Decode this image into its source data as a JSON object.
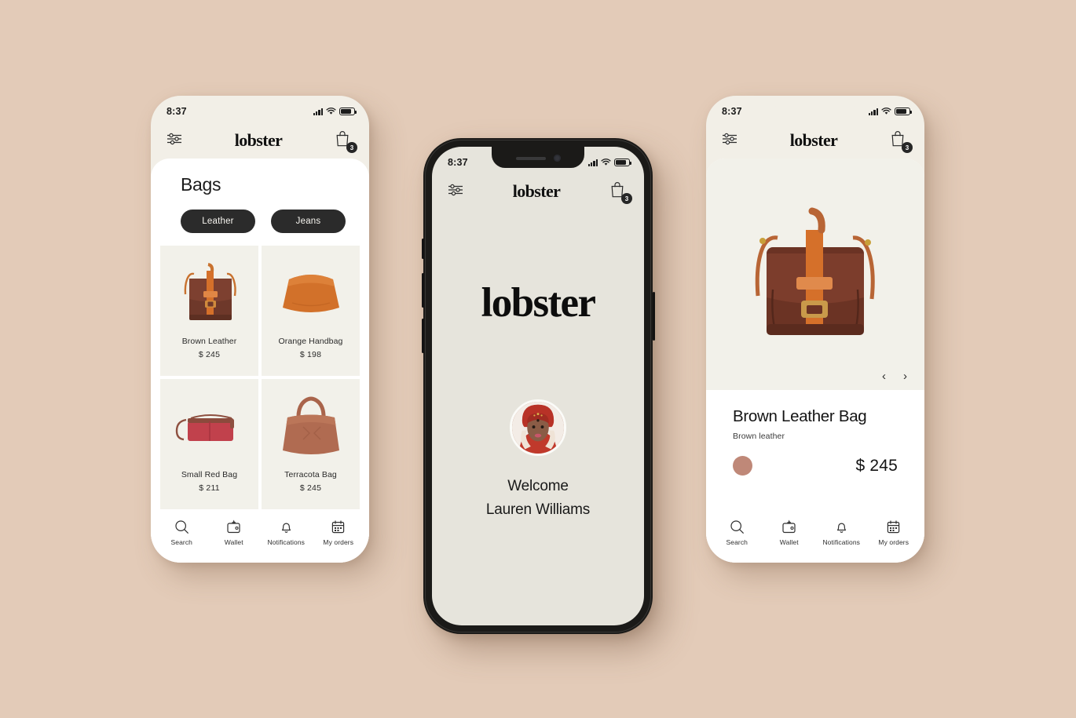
{
  "background_color": "#e3cbb8",
  "brand": "lobster",
  "status_bar": {
    "time": "8:37",
    "signal_icon": "cellular-signal-icon",
    "wifi_icon": "wifi-icon",
    "battery_icon": "battery-icon"
  },
  "header": {
    "filter_icon": "filter-sliders-icon",
    "cart_icon": "shopping-bag-icon",
    "cart_count": "3"
  },
  "catalogue_screen": {
    "title": "Bags",
    "filters": [
      {
        "label": "Leather"
      },
      {
        "label": "Jeans"
      }
    ],
    "products": [
      {
        "name": "Brown Leather",
        "price": "$ 245",
        "color": "#7b3f2c",
        "accent": "#d5702a"
      },
      {
        "name": "Orange Handbag",
        "price": "$ 198",
        "color": "#d2712a",
        "accent": "#b85d1d"
      },
      {
        "name": "Small Red Bag",
        "price": "$ 211",
        "color": "#c1414c",
        "accent": "#8e5040"
      },
      {
        "name": "Terracota Bag",
        "price": "$ 245",
        "color": "#b06b51",
        "accent": "#9c5b43"
      }
    ]
  },
  "welcome_screen": {
    "greeting": "Welcome",
    "user_name": "Lauren Williams",
    "avatar_icon": "user-avatar"
  },
  "detail_screen": {
    "product_title": "Brown Leather Bag",
    "product_subtitle": "Brown leather",
    "price": "$ 245",
    "color_swatch": "#bf8878",
    "prev_arrow": "‹",
    "next_arrow": "›"
  },
  "tabbar": {
    "items": [
      {
        "label": "Search",
        "icon": "search-icon"
      },
      {
        "label": "Wallet",
        "icon": "wallet-icon"
      },
      {
        "label": "Notifications",
        "icon": "bell-icon"
      },
      {
        "label": "My orders",
        "icon": "calendar-icon"
      }
    ]
  }
}
